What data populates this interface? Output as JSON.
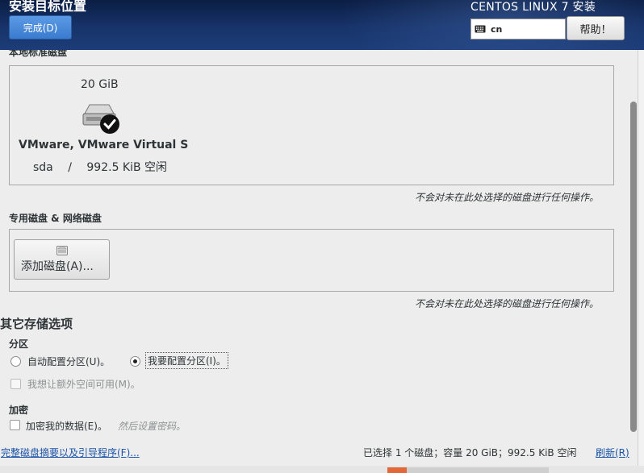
{
  "header": {
    "spoke_title": "安装目标位置",
    "done_label": "完成(D)",
    "product_title": "CENTOS LINUX 7 安装",
    "keyboard_layout": "cn",
    "help_label": "帮助！"
  },
  "local_disks": {
    "section_label": "本地标准磁盘",
    "disk": {
      "size": "20 GiB",
      "name": "VMware, VMware Virtual S",
      "device": "sda",
      "separator": "/",
      "free": "992.5 KiB 空闲",
      "selected": true
    },
    "note": "不会对未在此处选择的磁盘进行任何操作。"
  },
  "specialized_disks": {
    "section_label": "专用磁盘 & 网络磁盘",
    "add_button_label": "添加磁盘(A)...",
    "note": "不会对未在此处选择的磁盘进行任何操作。"
  },
  "other_storage": {
    "heading": "其它存储选项",
    "partitioning": {
      "label": "分区",
      "auto_label": "自动配置分区(U)。",
      "manual_label": "我要配置分区(I)。",
      "selected": "manual",
      "extra_space_label": "我想让额外空间可用(M)。"
    },
    "encryption": {
      "label": "加密",
      "encrypt_label": "加密我的数据(E)。",
      "hint": "然后设置密码。"
    }
  },
  "footer": {
    "summary_link": "完整磁盘摘要以及引导程序(F)...",
    "status": "已选择 1 个磁盘；容量 20 GiB；992.5 KiB 空闲",
    "refresh_link": "刷新(R)"
  },
  "colors": {
    "header_bg": "#17336a",
    "accent": "#3b7bcf",
    "link": "#1c54a8"
  }
}
